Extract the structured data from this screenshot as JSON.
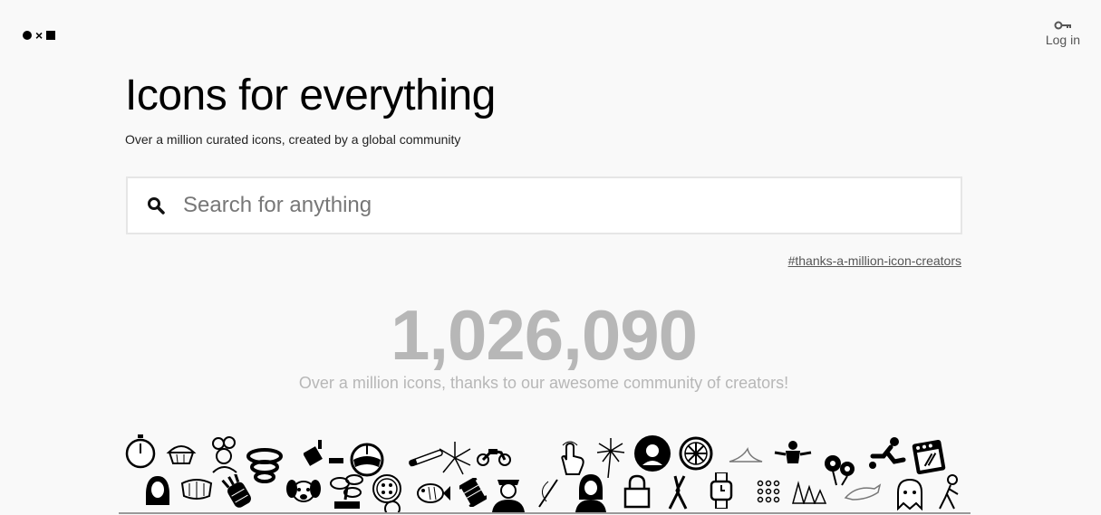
{
  "header": {
    "logo_icons": [
      "circle-icon",
      "times-icon",
      "square-icon"
    ],
    "logo_x": "×",
    "login_icon": "key-icon",
    "login_label": "Log in"
  },
  "hero": {
    "title": "Icons for everything",
    "subtitle": "Over a million curated icons, created by a global community"
  },
  "search": {
    "icon": "search-icon",
    "placeholder": "Search for anything",
    "value": ""
  },
  "community": {
    "hashtag": "#thanks-a-million-icon-creators",
    "count": "1,026,090",
    "message": "Over a million icons, thanks to our awesome community of creators!"
  },
  "collage": {
    "icons": [
      "stopwatch-icon",
      "hijab-woman-icon",
      "cupcake-icon",
      "dentures-icon",
      "chef-icon",
      "pineapple-icon",
      "spiral-icon",
      "lighter-icon",
      "dog-icon",
      "helmet-icon",
      "bonsai-icon",
      "button-icon",
      "cigarette-icon",
      "fish-icon",
      "fireworks-icon",
      "thread-spool-icon",
      "motorcycle-icon",
      "police-officer-icon",
      "needle-icon",
      "hand-tap-icon",
      "woman-icon",
      "dandelion-icon",
      "lock-icon",
      "person-portrait-icon",
      "pruning-shears-icon",
      "wheel-icon",
      "watch-icon",
      "bird-icon",
      "dots-grid-icon",
      "businessman-icon",
      "trees-icon",
      "flowers-icon",
      "dolphin-icon",
      "soccer-player-icon",
      "ghost-icon",
      "oven-icon",
      "person-walking-icon"
    ],
    "accent": "#000000"
  },
  "colors": {
    "background": "#f9f9f9",
    "counter": "#b7b7b7",
    "search_border": "#e6e6e6"
  }
}
